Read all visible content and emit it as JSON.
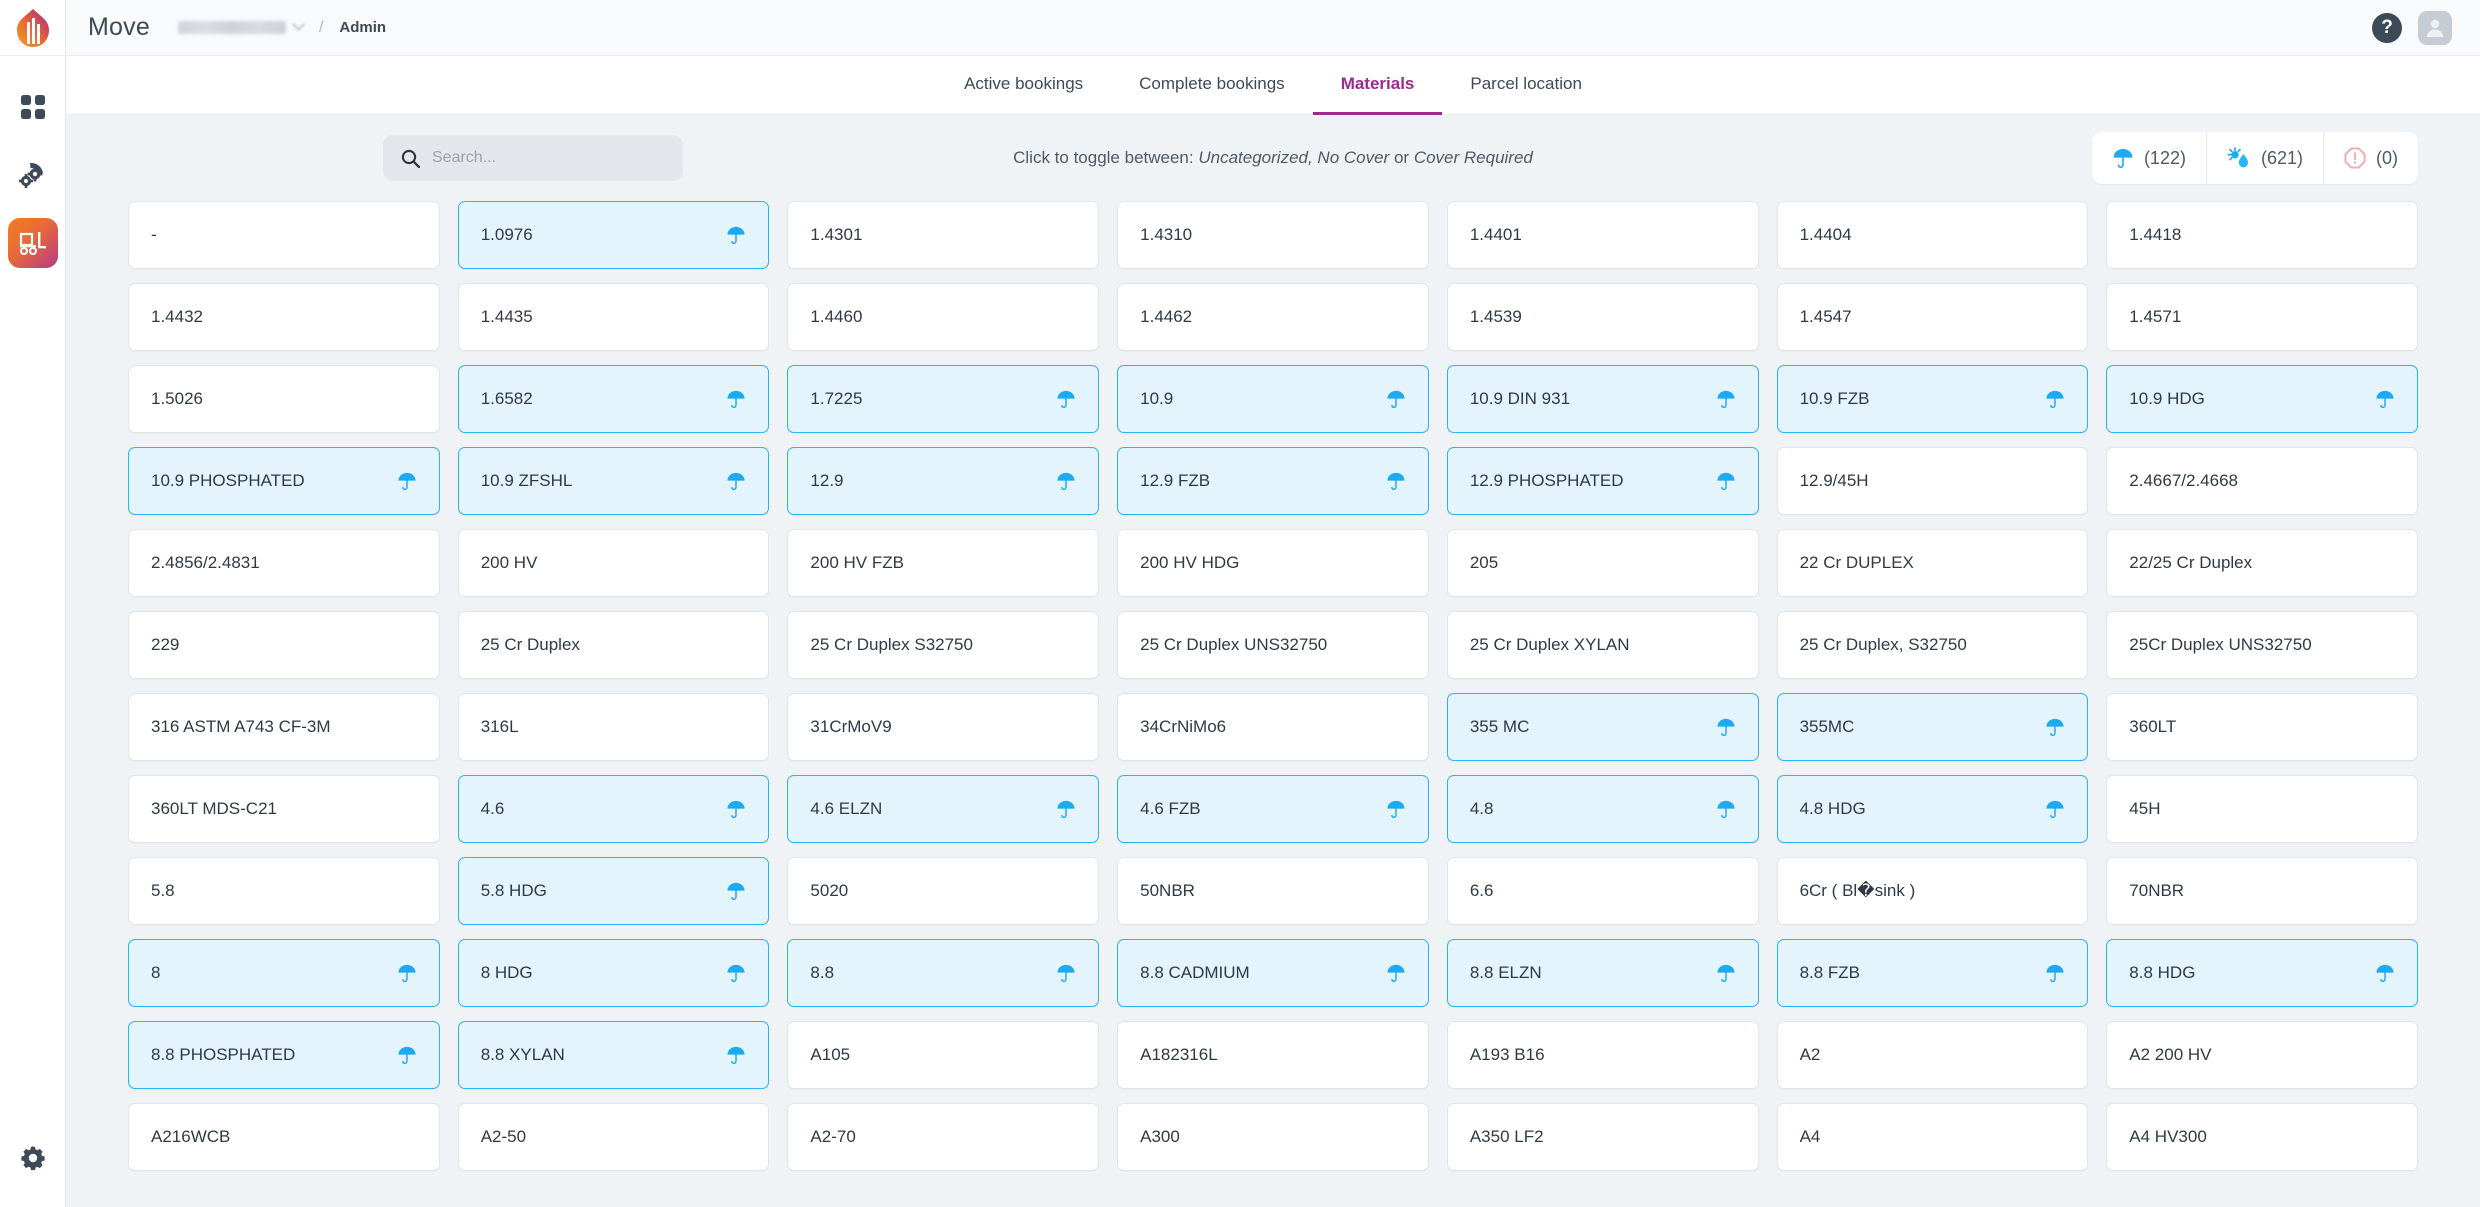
{
  "app": {
    "title": "Move",
    "org_redacted": "",
    "breadcrumb_separator": "/",
    "breadcrumb_current": "Admin",
    "help_label": "?"
  },
  "sidebar": {
    "items": [
      {
        "name": "dashboard",
        "icon": "grid-icon",
        "active": false
      },
      {
        "name": "settings-gears",
        "icon": "gears-icon",
        "active": false
      },
      {
        "name": "logistics",
        "icon": "forklift-icon",
        "active": true
      }
    ],
    "bottom": {
      "name": "settings",
      "icon": "gear-icon"
    }
  },
  "tabs": [
    {
      "label": "Active bookings",
      "active": false
    },
    {
      "label": "Complete bookings",
      "active": false
    },
    {
      "label": "Materials",
      "active": true
    },
    {
      "label": "Parcel location",
      "active": false
    }
  ],
  "search": {
    "value": "",
    "placeholder": "Search..."
  },
  "toggle_hint": {
    "prefix": "Click to toggle between:",
    "option_1": "Uncategorized, No Cover",
    "conjunction": "or",
    "option_2": "Cover Required"
  },
  "counters": [
    {
      "name": "cover-required-count",
      "icon": "umbrella-icon",
      "value": "(122)",
      "color": "#1eaaf1"
    },
    {
      "name": "no-cover-count",
      "icon": "sun-rain-icon",
      "value": "(621)",
      "color": "#1eaaf1"
    },
    {
      "name": "uncategorized-count",
      "icon": "warning-octagon-icon",
      "value": "(0)",
      "color": "#f4a9ad"
    }
  ],
  "colors": {
    "accent": "#9c2a8f",
    "page_bg": "#f0f3f6",
    "card_bg": "#ffffff",
    "card_selected_bg": "#e3f4fd",
    "card_selected_border": "#2eb3ef",
    "icon_blue": "#1eaaf1",
    "text": "#2f3a45"
  },
  "materials": [
    {
      "label": "-",
      "covered": false
    },
    {
      "label": "1.0976",
      "covered": true
    },
    {
      "label": "1.4301",
      "covered": false
    },
    {
      "label": "1.4310",
      "covered": false
    },
    {
      "label": "1.4401",
      "covered": false
    },
    {
      "label": "1.4404",
      "covered": false
    },
    {
      "label": "1.4418",
      "covered": false
    },
    {
      "label": "1.4432",
      "covered": false
    },
    {
      "label": "1.4435",
      "covered": false
    },
    {
      "label": "1.4460",
      "covered": false
    },
    {
      "label": "1.4462",
      "covered": false
    },
    {
      "label": "1.4539",
      "covered": false
    },
    {
      "label": "1.4547",
      "covered": false
    },
    {
      "label": "1.4571",
      "covered": false
    },
    {
      "label": "1.5026",
      "covered": false
    },
    {
      "label": "1.6582",
      "covered": true
    },
    {
      "label": "1.7225",
      "covered": true
    },
    {
      "label": "10.9",
      "covered": true
    },
    {
      "label": "10.9 DIN 931",
      "covered": true
    },
    {
      "label": "10.9 FZB",
      "covered": true
    },
    {
      "label": "10.9 HDG",
      "covered": true
    },
    {
      "label": "10.9 PHOSPHATED",
      "covered": true
    },
    {
      "label": "10.9 ZFSHL",
      "covered": true
    },
    {
      "label": "12.9",
      "covered": true
    },
    {
      "label": "12.9 FZB",
      "covered": true
    },
    {
      "label": "12.9 PHOSPHATED",
      "covered": true
    },
    {
      "label": "12.9/45H",
      "covered": false
    },
    {
      "label": "2.4667/2.4668",
      "covered": false
    },
    {
      "label": "2.4856/2.4831",
      "covered": false
    },
    {
      "label": "200 HV",
      "covered": false
    },
    {
      "label": "200 HV FZB",
      "covered": false
    },
    {
      "label": "200 HV HDG",
      "covered": false
    },
    {
      "label": "205",
      "covered": false
    },
    {
      "label": "22 Cr DUPLEX",
      "covered": false
    },
    {
      "label": "22/25 Cr Duplex",
      "covered": false
    },
    {
      "label": "229",
      "covered": false
    },
    {
      "label": "25 Cr Duplex",
      "covered": false
    },
    {
      "label": "25 Cr Duplex S32750",
      "covered": false
    },
    {
      "label": "25 Cr Duplex UNS32750",
      "covered": false
    },
    {
      "label": "25 Cr Duplex XYLAN",
      "covered": false
    },
    {
      "label": "25 Cr Duplex, S32750",
      "covered": false
    },
    {
      "label": "25Cr Duplex UNS32750",
      "covered": false
    },
    {
      "label": "316 ASTM A743 CF-3M",
      "covered": false
    },
    {
      "label": "316L",
      "covered": false
    },
    {
      "label": "31CrMoV9",
      "covered": false
    },
    {
      "label": "34CrNiMo6",
      "covered": false
    },
    {
      "label": "355 MC",
      "covered": true
    },
    {
      "label": "355MC",
      "covered": true
    },
    {
      "label": "360LT",
      "covered": false
    },
    {
      "label": "360LT MDS-C21",
      "covered": false
    },
    {
      "label": "4.6",
      "covered": true
    },
    {
      "label": "4.6 ELZN",
      "covered": true
    },
    {
      "label": "4.6 FZB",
      "covered": true
    },
    {
      "label": "4.8",
      "covered": true
    },
    {
      "label": "4.8 HDG",
      "covered": true
    },
    {
      "label": "45H",
      "covered": false
    },
    {
      "label": "5.8",
      "covered": false
    },
    {
      "label": "5.8 HDG",
      "covered": true
    },
    {
      "label": "5020",
      "covered": false
    },
    {
      "label": "50NBR",
      "covered": false
    },
    {
      "label": "6.6",
      "covered": false
    },
    {
      "label": "6Cr ( Bl�sink )",
      "covered": false
    },
    {
      "label": "70NBR",
      "covered": false
    },
    {
      "label": "8",
      "covered": true
    },
    {
      "label": "8 HDG",
      "covered": true
    },
    {
      "label": "8.8",
      "covered": true
    },
    {
      "label": "8.8 CADMIUM",
      "covered": true
    },
    {
      "label": "8.8 ELZN",
      "covered": true
    },
    {
      "label": "8.8 FZB",
      "covered": true
    },
    {
      "label": "8.8 HDG",
      "covered": true
    },
    {
      "label": "8.8 PHOSPHATED",
      "covered": true
    },
    {
      "label": "8.8 XYLAN",
      "covered": true
    },
    {
      "label": "A105",
      "covered": false
    },
    {
      "label": "A182316L",
      "covered": false
    },
    {
      "label": "A193 B16",
      "covered": false
    },
    {
      "label": "A2",
      "covered": false
    },
    {
      "label": "A2 200 HV",
      "covered": false
    },
    {
      "label": "A216WCB",
      "covered": false
    },
    {
      "label": "A2-50",
      "covered": false
    },
    {
      "label": "A2-70",
      "covered": false
    },
    {
      "label": "A300",
      "covered": false
    },
    {
      "label": "A350 LF2",
      "covered": false
    },
    {
      "label": "A4",
      "covered": false
    },
    {
      "label": "A4 HV300",
      "covered": false
    }
  ]
}
